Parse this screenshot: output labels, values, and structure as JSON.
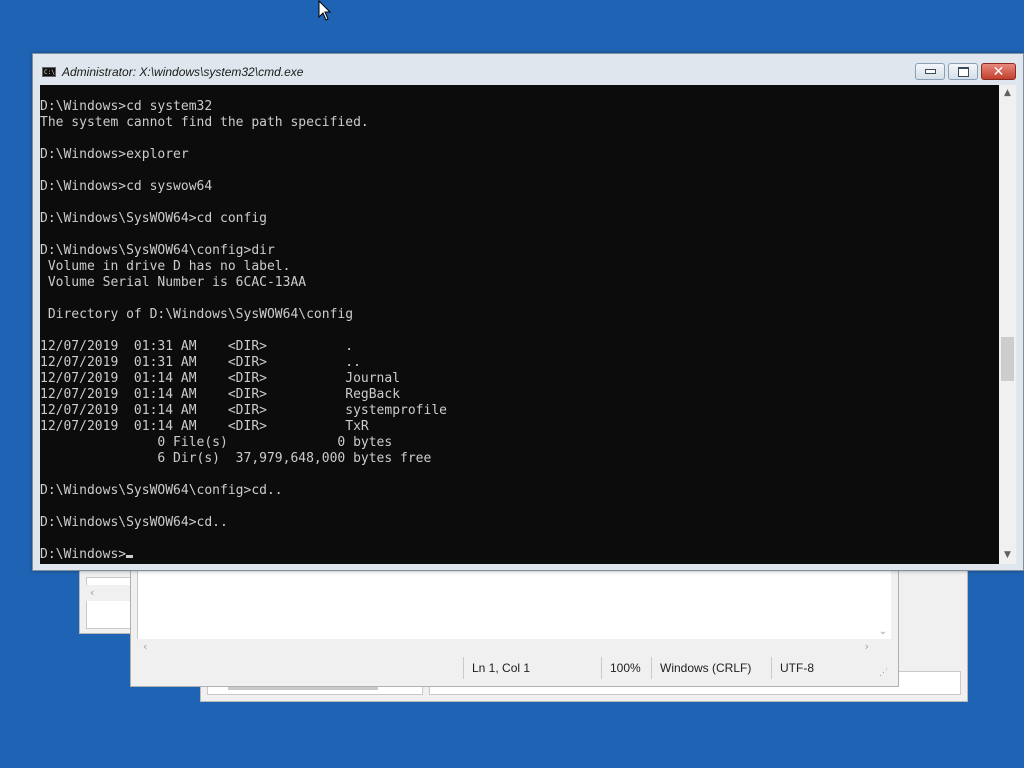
{
  "desktop": {
    "background_color": "#1f64b4"
  },
  "cmd_window": {
    "title": "Administrator: X:\\windows\\system32\\cmd.exe",
    "icon": "console-icon",
    "icon_label": "C:\\",
    "buttons": {
      "minimize": "minimize-icon",
      "maximize": "maximize-icon",
      "close": "close-icon"
    },
    "console_lines": [
      "D:\\Windows>cd system32",
      "The system cannot find the path specified.",
      "",
      "D:\\Windows>explorer",
      "",
      "D:\\Windows>cd syswow64",
      "",
      "D:\\Windows\\SysWOW64>cd config",
      "",
      "D:\\Windows\\SysWOW64\\config>dir",
      " Volume in drive D has no label.",
      " Volume Serial Number is 6CAC-13AA",
      "",
      " Directory of D:\\Windows\\SysWOW64\\config",
      "",
      "12/07/2019  01:31 AM    <DIR>          .",
      "12/07/2019  01:31 AM    <DIR>          ..",
      "12/07/2019  01:14 AM    <DIR>          Journal",
      "12/07/2019  01:14 AM    <DIR>          RegBack",
      "12/07/2019  01:14 AM    <DIR>          systemprofile",
      "12/07/2019  01:14 AM    <DIR>          TxR",
      "               0 File(s)              0 bytes",
      "               6 Dir(s)  37,979,648,000 bytes free",
      "",
      "D:\\Windows\\SysWOW64\\config>cd..",
      "",
      "D:\\Windows\\SysWOW64>cd..",
      ""
    ],
    "prompt": "D:\\Windows>",
    "console_bg": "#0c0c0c",
    "console_fg": "#cccccc"
  },
  "notepad_window": {
    "status": {
      "position": "Ln 1, Col 1",
      "zoom": "100%",
      "line_endings": "Windows (CRLF)",
      "encoding": "UTF-8"
    }
  }
}
